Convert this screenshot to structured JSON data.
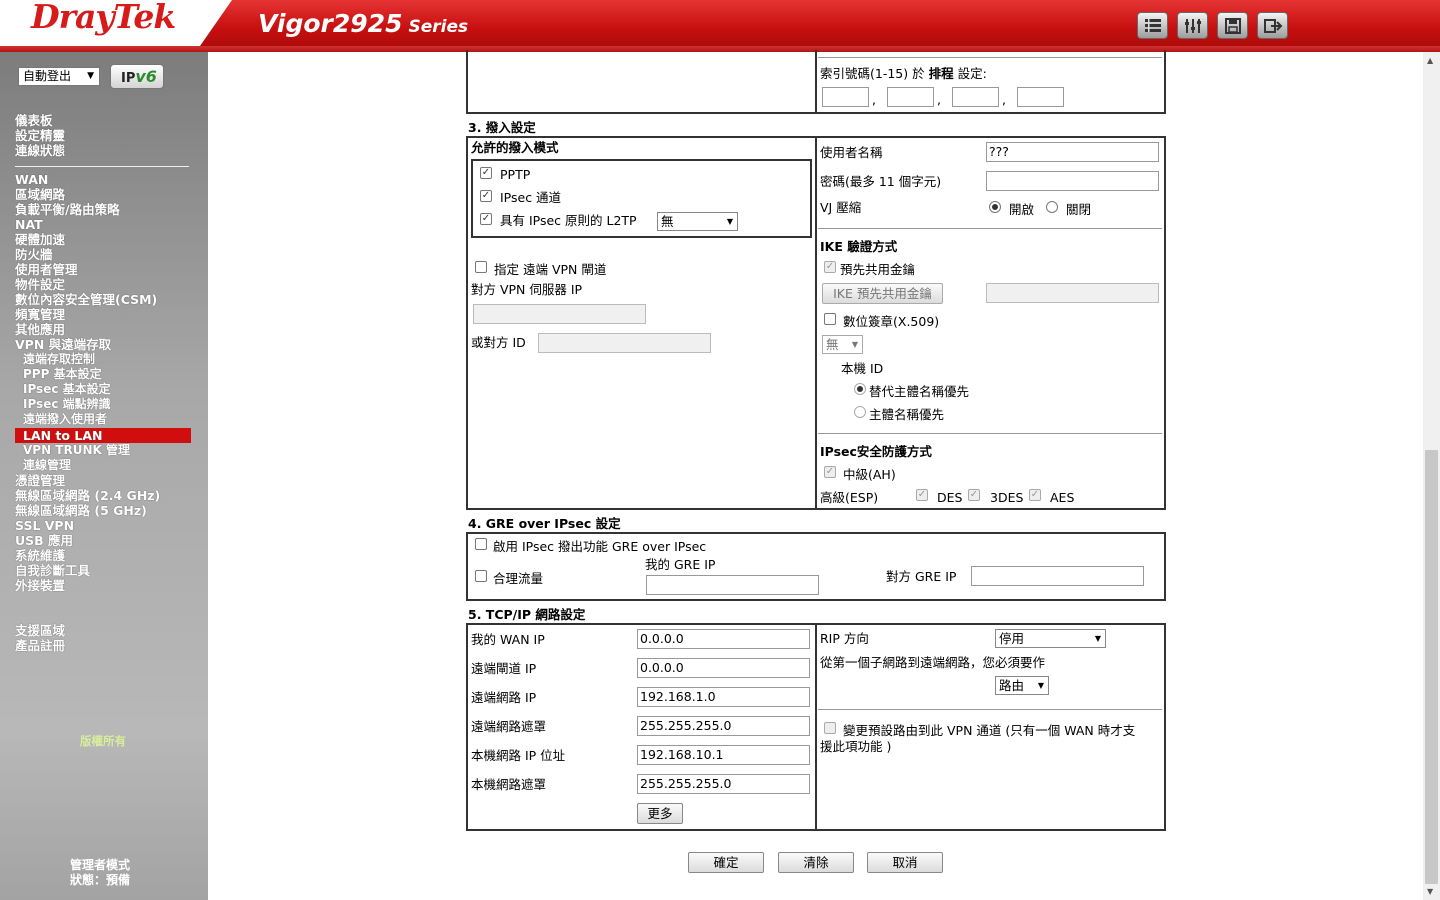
{
  "header": {
    "logo": "DrayTek",
    "model": "Vigor2925",
    "series": "Series"
  },
  "header_icons": [
    "layout-icon",
    "sliders-icon",
    "save-icon",
    "logout-icon"
  ],
  "sidebar": {
    "logout_select": "自動登出",
    "ipv6_label_a": "IP",
    "ipv6_label_b": "v6",
    "items": [
      {
        "label": "儀表板"
      },
      {
        "label": "設定精靈"
      },
      {
        "label": "連線狀態"
      },
      {
        "label": "WAN"
      },
      {
        "label": "區域網路"
      },
      {
        "label": "負載平衡/路由策略"
      },
      {
        "label": "NAT"
      },
      {
        "label": "硬體加速"
      },
      {
        "label": "防火牆"
      },
      {
        "label": "使用者管理"
      },
      {
        "label": "物件設定"
      },
      {
        "label": "數位內容安全管理(CSM)"
      },
      {
        "label": "頻寬管理"
      },
      {
        "label": "其他應用"
      },
      {
        "label": "VPN 與遠端存取"
      },
      {
        "label": "遠端存取控制"
      },
      {
        "label": "PPP 基本設定"
      },
      {
        "label": "IPsec 基本設定"
      },
      {
        "label": "IPsec 端點辨識"
      },
      {
        "label": "遠端撥入使用者"
      },
      {
        "label": "LAN to LAN"
      },
      {
        "label": "VPN TRUNK 管理"
      },
      {
        "label": "連線管理"
      },
      {
        "label": "憑證管理"
      },
      {
        "label": "無線區域網路 (2.4 GHz)"
      },
      {
        "label": "無線區域網路 (5 GHz)"
      },
      {
        "label": "SSL VPN"
      },
      {
        "label": "USB 應用"
      },
      {
        "label": "系統維護"
      },
      {
        "label": "自我診斷工具"
      },
      {
        "label": "外接裝置"
      },
      {
        "label": "支援區域"
      },
      {
        "label": "產品註冊"
      }
    ],
    "copyright": "版權所有",
    "mode_line1": "管理者模式",
    "mode_line2": "狀態：預備"
  },
  "schedule": {
    "label": "索引號碼(1-15) 於 ",
    "label_bold": "排程",
    "label_end": " 設定:",
    "sep": ","
  },
  "dialin": {
    "title": "3. 撥入設定",
    "allowed_title": "允許的撥入模式",
    "pptp": "PPTP",
    "ipsec": "IPsec 通道",
    "l2tp": "具有 IPsec 原則的 L2TP",
    "l2tp_policy": "無",
    "specify_remote": "指定 遠端 VPN 閘道",
    "peer_ip_label": "對方 VPN 伺服器 IP",
    "peer_id_label": "或對方 ID",
    "username_label": "使用者名稱",
    "username_value": "???",
    "password_label": "密碼(最多 11 個字元)",
    "vj_label": "VJ 壓縮",
    "vj_on": "開啟",
    "vj_off": "關閉",
    "ike_title": "IKE 驗證方式",
    "psk_label": "預先共用金鑰",
    "ike_psk_button": "IKE 預先共用金鑰",
    "cert_label": "數位簽章(X.509)",
    "cert_select": "無",
    "local_id_label": "本機 ID",
    "alt_subject": "替代主體名稱優先",
    "subject": "主體名稱優先",
    "ipsec_sec_title": "IPsec安全防護方式",
    "medium_ah": "中級(AH)",
    "high_esp": "高級(ESP)",
    "des": "DES",
    "tdes": "3DES",
    "aes": "AES"
  },
  "gre": {
    "title": "4. GRE over IPsec 設定",
    "enable_label": "啟用 IPsec 撥出功能 GRE over IPsec",
    "logical_traffic": "合理流量",
    "my_gre_ip": "我的 GRE IP",
    "peer_gre_ip": "對方 GRE IP"
  },
  "tcpip": {
    "title": "5. TCP/IP 網路設定",
    "my_wan_ip_label": "我的 WAN IP",
    "my_wan_ip": "0.0.0.0",
    "remote_gw_label": "遠端閘道 IP",
    "remote_gw": "0.0.0.0",
    "remote_net_label": "遠端網路 IP",
    "remote_net": "192.168.1.0",
    "remote_mask_label": "遠端網路遮罩",
    "remote_mask": "255.255.255.0",
    "local_ip_label": "本機網路 IP 位址",
    "local_ip": "192.168.10.1",
    "local_mask_label": "本機網路遮罩",
    "local_mask": "255.255.255.0",
    "more_button": "更多",
    "rip_label": "RIP 方向",
    "rip_value": "停用",
    "first_subnet_text": "從第一個子網路到遠端網路，您必須要作",
    "route_value": "路由",
    "change_default_line1": "變更預設路由到此 VPN 通道 (只有一個 WAN 時才支",
    "change_default_line2": "援此項功能 )"
  },
  "actions": {
    "ok": "確定",
    "clear": "清除",
    "cancel": "取消"
  }
}
